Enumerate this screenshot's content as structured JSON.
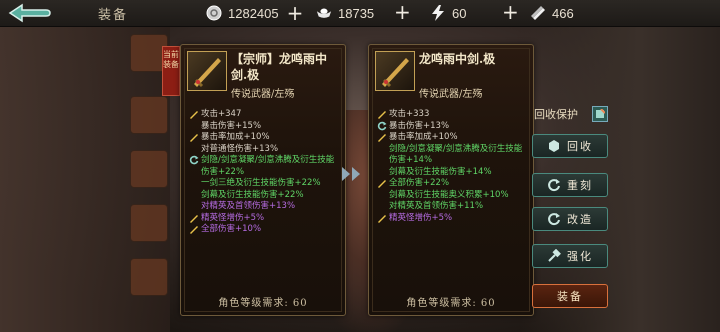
{
  "header": {
    "title": "装备",
    "currencies": [
      {
        "icon": "silver-coin-icon",
        "value": "1282405"
      },
      {
        "icon": "ingot-icon",
        "value": "18735"
      },
      {
        "icon": "lightning-icon",
        "value": "60"
      },
      {
        "icon": "ticket-icon",
        "value": "466"
      }
    ]
  },
  "current_item": {
    "tag": "当前装备",
    "name": "【宗师】龙鸣雨中剑.极",
    "type": "传说武器/左殇",
    "stats": [
      {
        "icon": "sword-icon",
        "text": "攻击+347",
        "color": "white"
      },
      {
        "icon": "",
        "text": "暴击伤害+15%",
        "color": "white"
      },
      {
        "icon": "sword-icon",
        "text": "暴击率加成+10%",
        "color": "white"
      },
      {
        "icon": "",
        "text": "对普通怪伤害+13%",
        "color": "white"
      },
      {
        "icon": "refresh-icon",
        "text": "剑隐/剑意凝聚/剑意沸腾及衍生技能伤害+22%",
        "color": "green"
      },
      {
        "icon": "",
        "text": "一剑三绝及衍生技能伤害+22%",
        "color": "green"
      },
      {
        "icon": "",
        "text": "剑幕及衍生技能伤害+22%",
        "color": "green"
      },
      {
        "icon": "",
        "text": "对精英及首领伤害+13%",
        "color": "purple"
      },
      {
        "icon": "sword-icon",
        "text": "精英怪增伤+5%",
        "color": "purple"
      },
      {
        "icon": "sword-icon",
        "text": "全部伤害+10%",
        "color": "purple"
      }
    ],
    "requirement": "角色等级需求: 60"
  },
  "compare_item": {
    "name": "龙鸣雨中剑.极",
    "type": "传说武器/左殇",
    "stats": [
      {
        "icon": "sword-icon",
        "text": "攻击+333",
        "color": "white"
      },
      {
        "icon": "refresh-icon",
        "text": "暴击伤害+13%",
        "color": "white"
      },
      {
        "icon": "sword-icon",
        "text": "暴击率加成+10%",
        "color": "white"
      },
      {
        "icon": "",
        "text": "剑隐/剑意凝聚/剑意沸腾及衍生技能伤害+14%",
        "color": "green"
      },
      {
        "icon": "",
        "text": "剑幕及衍生技能伤害+14%",
        "color": "green"
      },
      {
        "icon": "sword-icon",
        "text": "全部伤害+22%",
        "color": "green"
      },
      {
        "icon": "",
        "text": "剑幕及衍生技能奥义积累+10%",
        "color": "green"
      },
      {
        "icon": "",
        "text": "对精英及首领伤害+11%",
        "color": "green"
      },
      {
        "icon": "sword-icon",
        "text": "精英怪增伤+5%",
        "color": "purple"
      }
    ],
    "requirement": "角色等级需求: 60"
  },
  "actions": {
    "recycle_protect": "回收保护",
    "buttons": [
      {
        "label": "回收",
        "icon": "recycle-icon"
      },
      {
        "label": "重刻",
        "icon": "reforge-icon"
      },
      {
        "label": "改造",
        "icon": "modify-icon"
      },
      {
        "label": "强化",
        "icon": "hammer-icon"
      }
    ],
    "equip": "装备"
  },
  "colors": {
    "white": "#d9d2c6",
    "green": "#5fd466",
    "purple": "#b46be0",
    "accent": "#4a8a7e",
    "equip": "#d8703c"
  }
}
